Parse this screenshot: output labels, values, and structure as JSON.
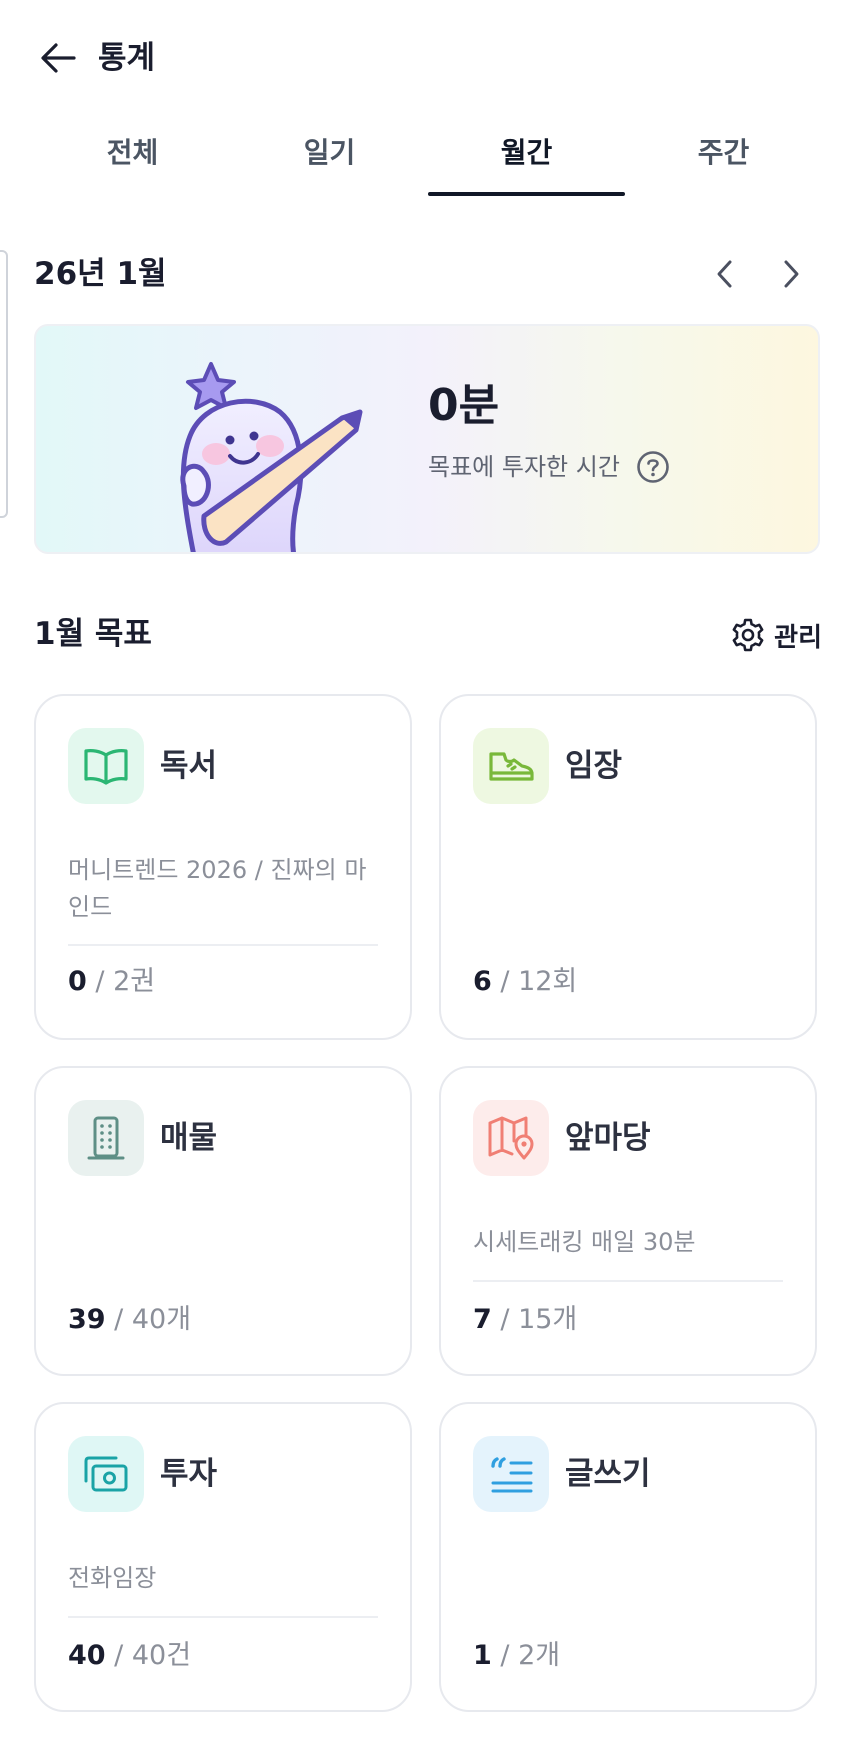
{
  "header": {
    "title": "통계"
  },
  "tabs": [
    {
      "label": "전체",
      "active": false
    },
    {
      "label": "일기",
      "active": false
    },
    {
      "label": "월간",
      "active": true
    },
    {
      "label": "주간",
      "active": false
    }
  ],
  "period": {
    "label": "26년 1월"
  },
  "summary": {
    "value": "0분",
    "caption": "목표에 투자한 시간"
  },
  "goals": {
    "title": "1월 목표",
    "manage_label": "관리",
    "items": [
      {
        "icon": "book-icon",
        "title": "독서",
        "description": "머니트렌드 2026 / 진짜의 마인드",
        "current": "0",
        "target": "/ 2권",
        "accent": "#2bb673",
        "icon_bg": "#e3f8ee"
      },
      {
        "icon": "sneaker-icon",
        "title": "임장",
        "description": "",
        "current": "6",
        "target": "/ 12회",
        "accent": "#79b83a",
        "icon_bg": "#eef8e1"
      },
      {
        "icon": "building-icon",
        "title": "매물",
        "description": "",
        "current": "39",
        "target": "/ 40개",
        "accent": "#5e8f86",
        "icon_bg": "#e9f1ef"
      },
      {
        "icon": "map-pin-icon",
        "title": "앞마당",
        "description": "시세트래킹 매일 30분",
        "current": "7",
        "target": "/ 15개",
        "accent": "#f07f74",
        "icon_bg": "#fdeceb"
      },
      {
        "icon": "cash-icon",
        "title": "투자",
        "description": "전화임장",
        "current": "40",
        "target": "/ 40건",
        "accent": "#1aa3a6",
        "icon_bg": "#dff7f5"
      },
      {
        "icon": "quote-icon",
        "title": "글쓰기",
        "description": "",
        "current": "1",
        "target": "/ 2개",
        "accent": "#2f9fe0",
        "icon_bg": "#e4f3fc"
      }
    ]
  }
}
